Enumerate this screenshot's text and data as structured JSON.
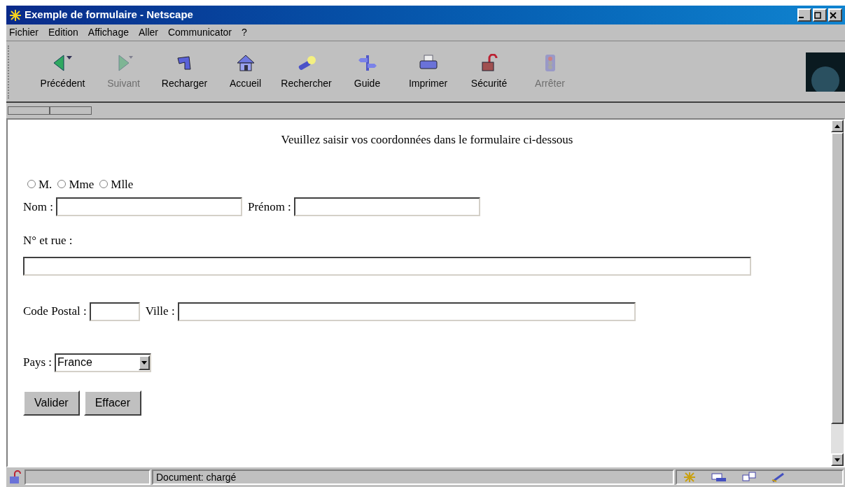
{
  "window": {
    "title": "Exemple de formulaire - Netscape"
  },
  "menu": [
    "Fichier",
    "Edition",
    "Affichage",
    "Aller",
    "Communicator",
    "?"
  ],
  "toolbar": [
    {
      "label": "Précédent",
      "kind": "back",
      "disabled": false
    },
    {
      "label": "Suivant",
      "kind": "forward",
      "disabled": true
    },
    {
      "label": "Recharger",
      "kind": "reload",
      "disabled": false
    },
    {
      "label": "Accueil",
      "kind": "home",
      "disabled": false
    },
    {
      "label": "Rechercher",
      "kind": "search",
      "disabled": false
    },
    {
      "label": "Guide",
      "kind": "guide",
      "disabled": false
    },
    {
      "label": "Imprimer",
      "kind": "print",
      "disabled": false
    },
    {
      "label": "Sécurité",
      "kind": "security",
      "disabled": false
    },
    {
      "label": "Arrêter",
      "kind": "stop",
      "disabled": true
    }
  ],
  "form": {
    "heading": "Veuillez saisir vos coordonnées dans le formulaire ci-dessous",
    "civility": [
      {
        "label": "M.",
        "selected": false
      },
      {
        "label": "Mme",
        "selected": false
      },
      {
        "label": "Mlle",
        "selected": false
      }
    ],
    "nom_label": "Nom :",
    "prenom_label": "Prénom :",
    "rue_label": "N° et rue :",
    "cp_label": "Code Postal :",
    "ville_label": "Ville :",
    "pays_label": "Pays :",
    "pays_value": "France",
    "buttons": [
      "Valider",
      "Effacer"
    ]
  },
  "status_bar": {
    "text": "Document: chargé"
  }
}
